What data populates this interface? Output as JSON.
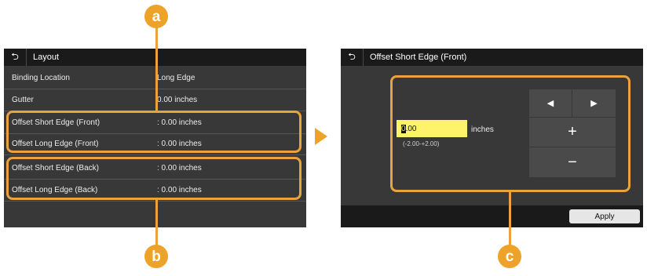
{
  "left_screen": {
    "title": "Layout",
    "rows": [
      {
        "label": "Binding Location",
        "value": "Long Edge"
      },
      {
        "label": "Gutter",
        "value": "0.00 inches"
      },
      {
        "label": "Offset Short Edge (Front)",
        "value": ": 0.00 inches"
      },
      {
        "label": "Offset Long Edge (Front)",
        "value": ": 0.00 inches"
      },
      {
        "label": "Offset Short Edge (Back)",
        "value": ": 0.00 inches"
      },
      {
        "label": "Offset Long Edge (Back)",
        "value": ": 0.00 inches"
      }
    ]
  },
  "right_screen": {
    "title": "Offset Short Edge (Front)",
    "input_caret": "0",
    "input_rest": ".00",
    "unit": "inches",
    "range": "(-2.00-+2.00)",
    "apply_label": "Apply"
  },
  "callouts": {
    "a": "a",
    "b": "b",
    "c": "c"
  },
  "icons": {
    "back": "back-arrow-icon",
    "left": "left-arrow-icon",
    "right": "right-arrow-icon",
    "plus": "plus-icon",
    "minus": "minus-icon"
  },
  "colors": {
    "accent": "#eda32a",
    "input": "#fff36b",
    "screen": "#383838"
  }
}
